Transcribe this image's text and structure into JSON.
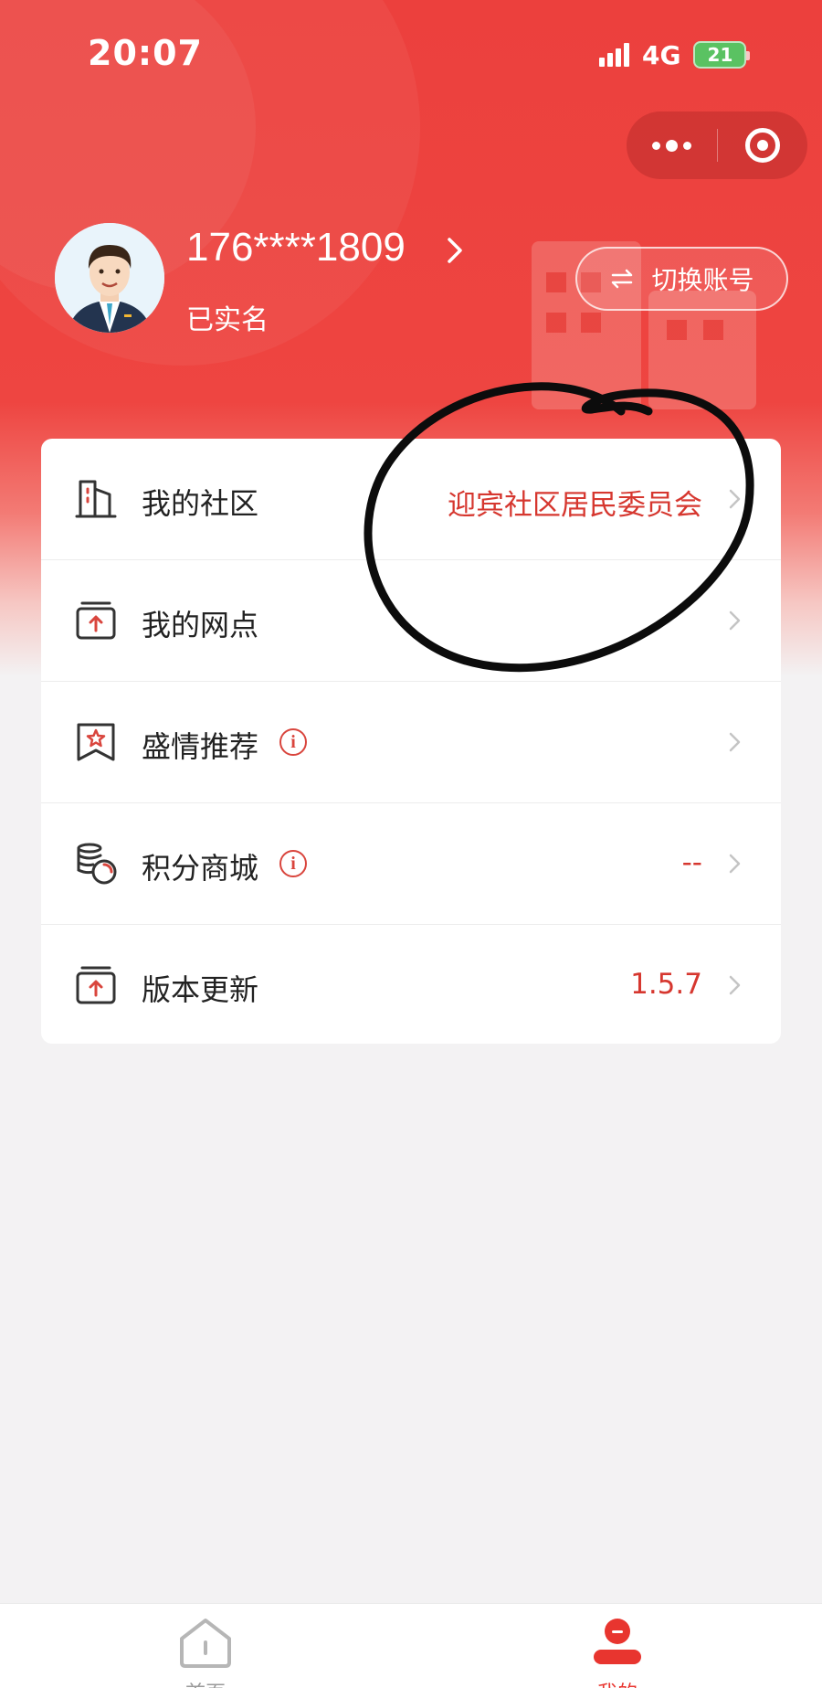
{
  "status_bar": {
    "time": "20:07",
    "network": "4G",
    "battery": "21"
  },
  "header": {
    "phone": "176****1809",
    "verify_status": "已实名",
    "switch_account_label": "切换账号"
  },
  "menu": [
    {
      "label": "我的社区",
      "value": "迎宾社区居民委员会",
      "icon": "building-icon",
      "info": false
    },
    {
      "label": "我的网点",
      "value": "",
      "icon": "upload-box-icon",
      "info": false
    },
    {
      "label": "盛情推荐",
      "value": "",
      "icon": "star-bookmark-icon",
      "info": true
    },
    {
      "label": "积分商城",
      "value": "--",
      "icon": "coins-icon",
      "info": true
    },
    {
      "label": "版本更新",
      "value": "1.5.7",
      "icon": "upload-box-icon",
      "info": false
    }
  ],
  "tabbar": {
    "home_label": "首页",
    "mine_label": "我的"
  },
  "colors": {
    "brand_red": "#ec403d",
    "value_red": "#d6372f",
    "battery_green": "#5ac262"
  }
}
